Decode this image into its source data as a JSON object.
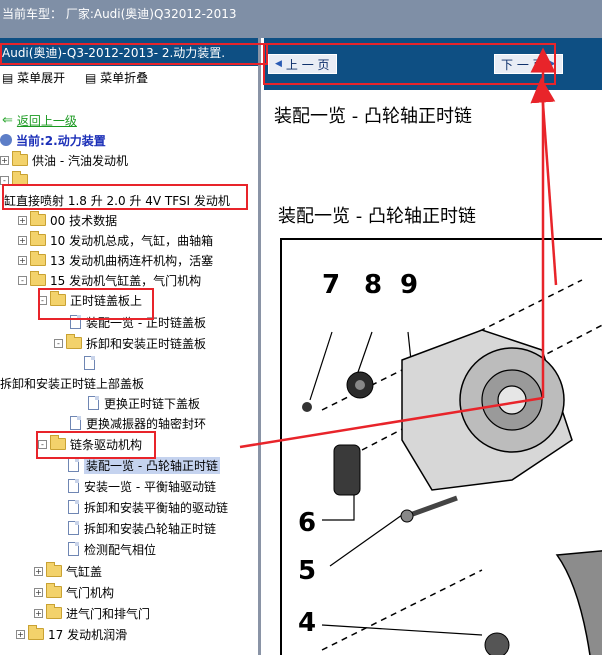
{
  "titlebar": {
    "text": "当前车型： 厂家:Audi(奥迪)Q32012-2013"
  },
  "left_panel": {
    "header": "Audi(奥迪)-Q3-2012-2013- 2.动力装置.",
    "expand_all": "菜单展开",
    "collapse_all": "菜单折叠",
    "back": "返回上一级",
    "current": "当前:2.动力装置",
    "tree": [
      {
        "label": "供油 - 汽油发动机"
      },
      {
        "label": ""
      },
      {
        "label": "缸直接喷射 1.8 升 2.0 升 4V TFSI 发动机"
      },
      {
        "label": "00 技术数据"
      },
      {
        "label": "10 发动机总成，气缸，曲轴箱"
      },
      {
        "label": "13 发动机曲柄连杆机构，活塞"
      },
      {
        "label": "15 发动机气缸盖，气门机构"
      },
      {
        "label": "正时链盖板上"
      },
      {
        "label": "装配一览 - 正时链盖板"
      },
      {
        "label": "拆卸和安装正时链盖板"
      },
      {
        "label": ""
      },
      {
        "label": "拆卸和安装正时链上部盖板"
      },
      {
        "label": "更换正时链下盖板"
      },
      {
        "label": "更换减振器的轴密封环"
      },
      {
        "label": "链条驱动机构"
      },
      {
        "label": "装配一览 - 凸轮轴正时链"
      },
      {
        "label": "安装一览 - 平衡轴驱动链"
      },
      {
        "label": "拆卸和安装平衡轴的驱动链"
      },
      {
        "label": "拆卸和安装凸轮轴正时链"
      },
      {
        "label": "检测配气相位"
      },
      {
        "label": "气缸盖"
      },
      {
        "label": "气门机构"
      },
      {
        "label": "进气门和排气门"
      },
      {
        "label": "17 发动机润滑"
      }
    ]
  },
  "right_panel": {
    "prev_button": "上 一 页",
    "next_button": "下 一 页",
    "title": "装配一览  - 凸轮轴正时链",
    "subtitle": "装配一览  - 凸轮轴正时链",
    "callouts": [
      "7",
      "8",
      "9",
      "6",
      "5",
      "4"
    ]
  },
  "colors": {
    "header_blue": "#0e4f83",
    "highlight_red": "#e8242a",
    "link_green": "#1c9a22",
    "current_blue": "#1b2fb8"
  }
}
